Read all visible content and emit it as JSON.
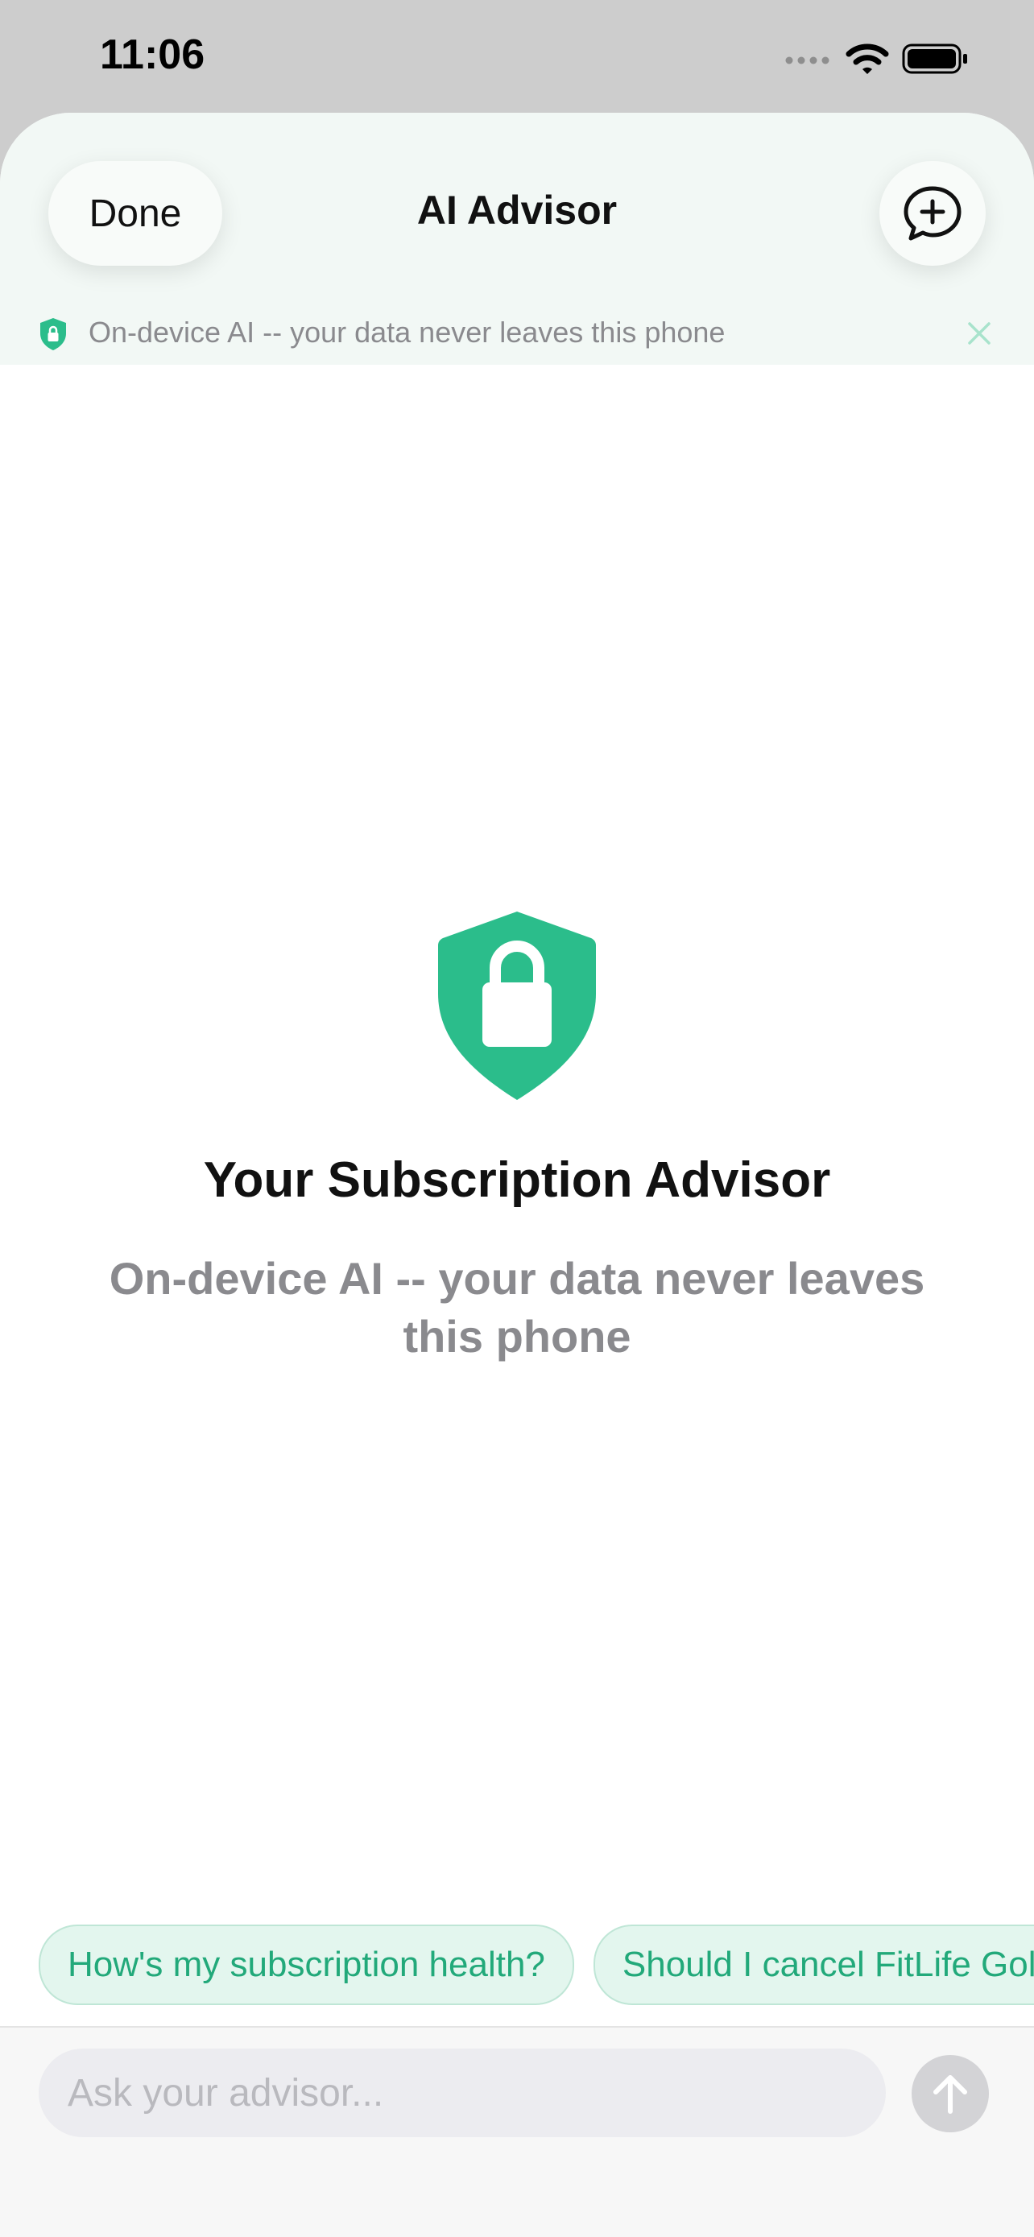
{
  "status_bar": {
    "time": "11:06"
  },
  "nav": {
    "done_label": "Done",
    "title": "AI Advisor",
    "new_chat_icon": "chat-bubble-plus-icon"
  },
  "privacy_banner": {
    "text": "On-device AI -- your data never leaves this phone",
    "icon": "shield-lock-icon",
    "close_icon": "close-icon"
  },
  "hero": {
    "icon": "shield-lock-icon",
    "title": "Your Subscription Advisor",
    "subtitle": "On-device AI -- your data never leaves this phone"
  },
  "suggestions": [
    {
      "label": "How's my subscription health?"
    },
    {
      "label": "Should I cancel FitLife Gold?"
    }
  ],
  "composer": {
    "placeholder": "Ask your advisor...",
    "send_icon": "arrow-up-icon"
  },
  "colors": {
    "accent": "#2bbd8b",
    "chip_background": "#e3f6ee",
    "chip_text": "#22a97a",
    "nav_background": "#f2f8f5",
    "secondary_text": "#8a8a8e"
  }
}
